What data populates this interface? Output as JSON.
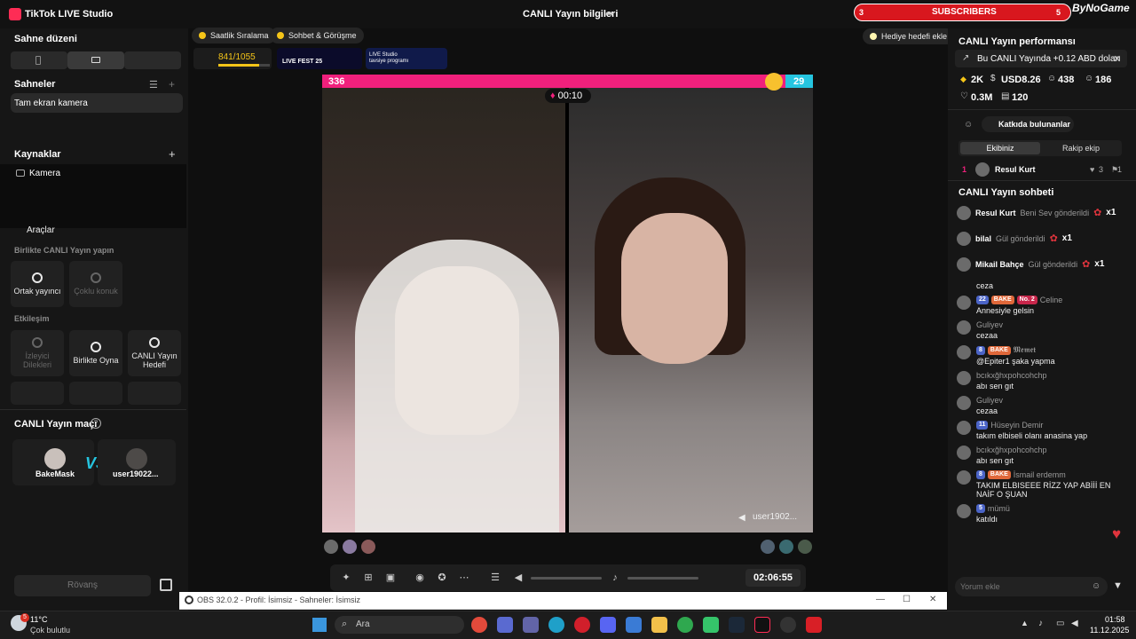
{
  "app": {
    "name": "TikTok LIVE Studio",
    "window_title": "CANLI Yayın bilgileri"
  },
  "overlay": {
    "subscribers_label": "SUBSCRIBERS",
    "subscribers_left": "3",
    "subscribers_right": "5",
    "brand": "ByNoGame"
  },
  "left": {
    "scene_layout_title": "Sahne düzeni",
    "scenes_title": "Sahneler",
    "scene_item": "Tam ekran kamera",
    "sources_title": "Kaynaklar",
    "source_item": "Kamera",
    "tools_title": "Araçlar",
    "collab_title": "Birlikte CANLI Yayın yapın",
    "collab_tools": [
      "Ortak yayıncı",
      "Çoklu konuk"
    ],
    "interaction_title": "Etkileşim",
    "interaction_tools": [
      "İzleyici Dilekleri",
      "Birlikte Oyna",
      "CANLI Yayın Hedefi"
    ],
    "match_title": "CANLI Yayın maçı",
    "match_help": "?",
    "player1": "BakeMask",
    "player2": "user19022...",
    "vs": "VS",
    "rematch": "Rövanş"
  },
  "center": {
    "chips": [
      "Saatlik Sıralama",
      "Sohbet & Görüşme"
    ],
    "goal_chip": "Hediye hedefi ekle",
    "progress_text": "841/1055",
    "progress_fraction": 0.8,
    "event1": "LIVE FEST 25",
    "event2": "LIVE Studio tavsiye programı",
    "score_left": "336",
    "score_right": "29",
    "timer": "00:10",
    "opponent_name": "user1902...",
    "elapsed": "02:06:55"
  },
  "right": {
    "perf_title": "CANLI Yayın performansı",
    "perf_note": "Bu CANLI Yayında +0.12 ABD doları",
    "stats": [
      "2K",
      "USD8.26",
      "438",
      "186",
      "0.3M",
      "120"
    ],
    "contributors": "Katkıda bulunanlar",
    "tabs": [
      "Ekibiniz",
      "Rakip ekip"
    ],
    "top_rank": "1",
    "top_user": "Resul Kurt",
    "top_likes": "3",
    "top_count": "1",
    "chat_title": "CANLI Yayın sohbeti",
    "gifts": [
      {
        "name": "Resul Kurt",
        "text": "Beni Sev gönderildi",
        "count": "x1"
      },
      {
        "name": "bilal",
        "text": "Gül gönderildi",
        "count": "x1"
      },
      {
        "name": "Mikail Bahçe",
        "text": "Gül gönderildi",
        "count": "x1"
      }
    ],
    "messages": [
      {
        "name": "",
        "text": "ceza"
      },
      {
        "name": "Celine",
        "text": "Annesiyle gelsin",
        "badge1": "22",
        "badge2": "BAKE",
        "badge3": "No. 2"
      },
      {
        "name": "Guliyev",
        "text": "cezaa"
      },
      {
        "name": "𝕸𝖊𝖒𝖊𝖙",
        "text": "@Epiter1 şaka yapma",
        "badge1": "8",
        "badge2": "BAKE"
      },
      {
        "name": "bcıkxğhxpohcohchp",
        "text": "abı sen gıt"
      },
      {
        "name": "Guliyev",
        "text": "cezaa"
      },
      {
        "name": "Hüseyin Demir",
        "text": "takım elbiseli olanı anasina yap",
        "badge1": "11"
      },
      {
        "name": "bcıkxğhxpohcohchp",
        "text": "abı sen gıt"
      },
      {
        "name": "İsmail erdemm",
        "text": "TAKIM ELBISEEE RİZZ YAP ABİİİ EN NAİF O ŞUAN",
        "badge1": "8",
        "badge2": "BAKE"
      },
      {
        "name": "mümü",
        "text": "katıldı",
        "badge1": "5"
      }
    ],
    "comment_placeholder": "Yorum ekle"
  },
  "obs": {
    "title": "OBS 32.0.2 - Profil: İsimsiz - Sahneler: İsimsiz"
  },
  "taskbar": {
    "temp": "11°C",
    "weather": "Çok bulutlu",
    "search": "Ara",
    "time": "01:58",
    "date": "11.12.2025",
    "notif": "5"
  },
  "colors": {
    "accent_red": "#f0207c",
    "accent_blue": "#25c5e0",
    "tiktok": "#fe2c55"
  }
}
